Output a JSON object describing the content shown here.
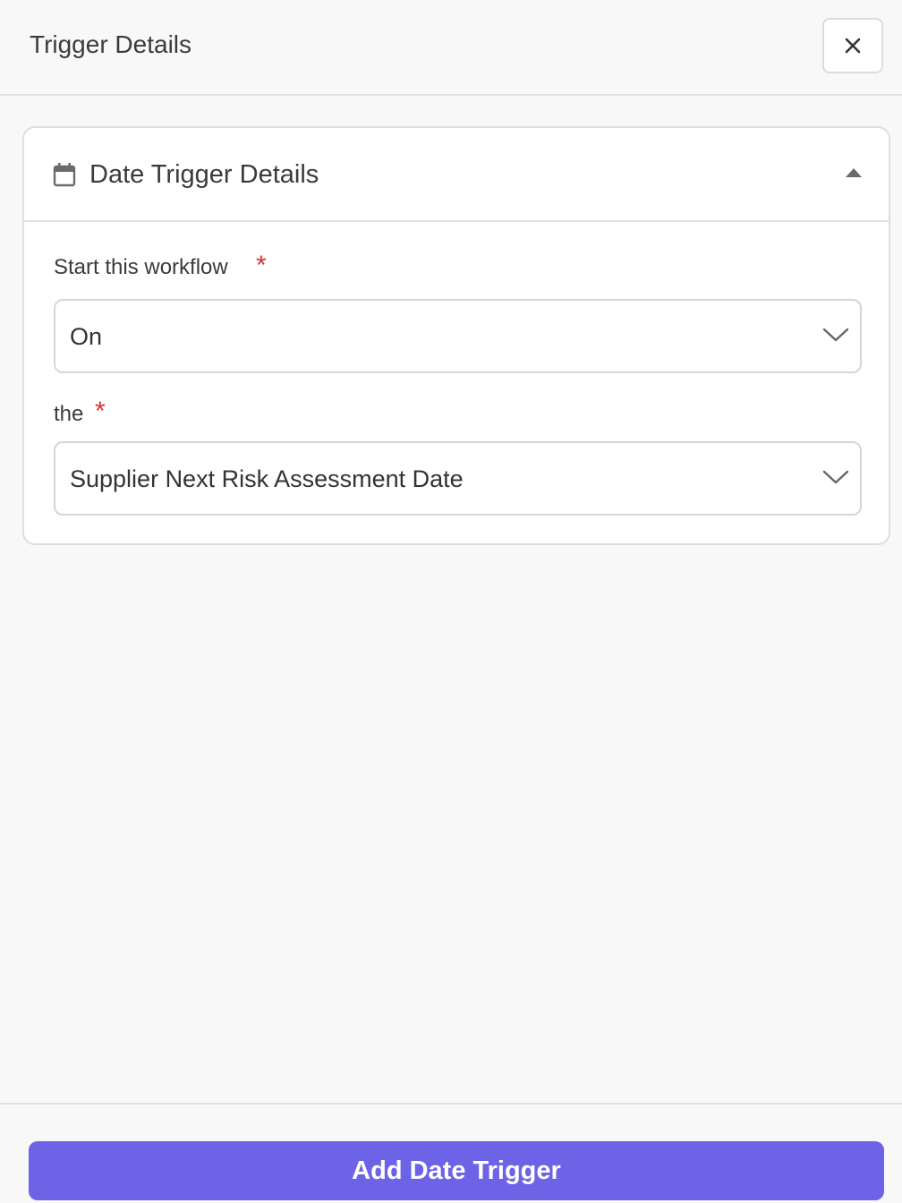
{
  "header": {
    "title": "Trigger Details",
    "close_icon": "close-icon"
  },
  "card": {
    "icon": "calendar-icon",
    "title": "Date Trigger Details",
    "collapse_icon": "caret-up-icon",
    "fields": [
      {
        "label": "Start this workflow",
        "required": "*",
        "value": "On"
      },
      {
        "label": "the",
        "required": "*",
        "value": "Supplier Next Risk Assessment Date"
      }
    ]
  },
  "footer": {
    "primary_label": "Add Date Trigger"
  },
  "colors": {
    "accent": "#6c63e6",
    "required": "#d93535",
    "background": "#f8f8f8"
  }
}
